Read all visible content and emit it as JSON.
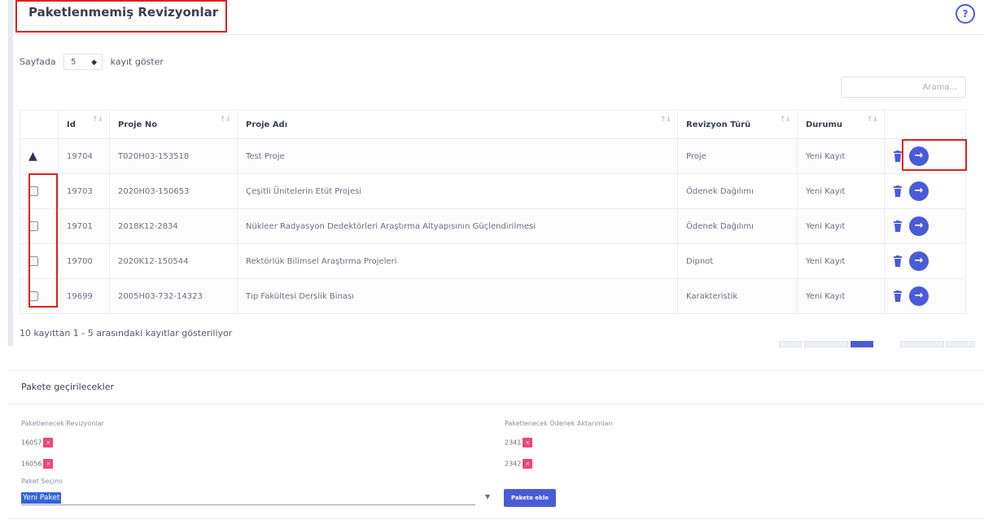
{
  "unpackaged": {
    "title": "Paketlenmemiş Revizyonlar",
    "help_label": "?",
    "length_prefix": "Sayfada",
    "length_value": "5",
    "length_suffix": "kayıt göster",
    "search_placeholder": "Arama...",
    "columns": [
      "Id",
      "Proje No",
      "Proje Adı",
      "Revizyon Türü",
      "Durumu"
    ],
    "rows": [
      {
        "id": "19704",
        "proje_no": "T020H03-153518",
        "proje_adi": "Test Proje",
        "revizyon_turu": "Proje",
        "durumu": "Yeni Kayıt",
        "warning": true
      },
      {
        "id": "19703",
        "proje_no": "2020H03-150653",
        "proje_adi": "Çeşitli Ünitelerin Etüt Projesi",
        "revizyon_turu": "Ödenek Dağılımı",
        "durumu": "Yeni Kayıt",
        "warning": false
      },
      {
        "id": "19701",
        "proje_no": "2018K12-2834",
        "proje_adi": "Nükleer Radyasyon Dedektörleri Araştırma Altyapısının Güçlendirilmesi",
        "revizyon_turu": "Ödenek Dağılımı",
        "durumu": "Yeni Kayıt",
        "warning": false
      },
      {
        "id": "19700",
        "proje_no": "2020K12-150544",
        "proje_adi": "Rektörlük Bilimsel Araştırma Projeleri",
        "revizyon_turu": "Dipnot",
        "durumu": "Yeni Kayıt",
        "warning": false
      },
      {
        "id": "19699",
        "proje_no": "2005H03-732-14323",
        "proje_adi": "Tıp Fakültesi Derslik Binası",
        "revizyon_turu": "Karakteristik",
        "durumu": "Yeni Kayıt",
        "warning": false
      }
    ],
    "info": "10 kayıttan 1 - 5 arasındaki kayıtlar gösteriliyor"
  },
  "to_package": {
    "title": "Pakete geçirilecekler",
    "revisions_label": "Paketlenecek Revizyonlar",
    "revisions": [
      "16057",
      "16056"
    ],
    "transfers_label": "Paketlenecek Ödenek Aktarımları",
    "transfers": [
      "2341",
      "2342"
    ],
    "remove_label": "×",
    "package_label": "Paket Seçimi",
    "package_value": "Yeni Paket",
    "add_button": "Pakete ekle"
  },
  "colors": {
    "accent": "#4a5bd8",
    "highlight": "#e02020",
    "remove_badge": "#f0457a"
  }
}
